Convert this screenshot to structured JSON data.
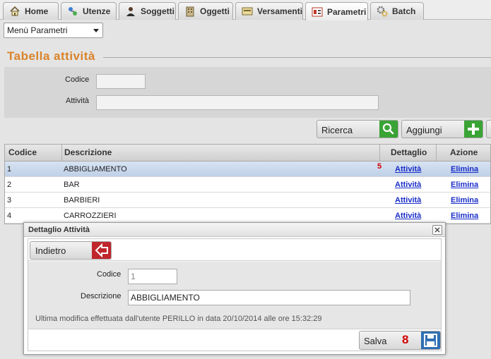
{
  "tabs": [
    {
      "label": "Home",
      "icon": "home-icon"
    },
    {
      "label": "Utenze",
      "icon": "network-icon"
    },
    {
      "label": "Soggetti",
      "icon": "person-icon"
    },
    {
      "label": "Oggetti",
      "icon": "building-icon"
    },
    {
      "label": "Versamenti",
      "icon": "payment-icon"
    },
    {
      "label": "Parametri",
      "icon": "parameters-icon",
      "active": true
    },
    {
      "label": "Batch",
      "icon": "gears-icon"
    }
  ],
  "toolbar": {
    "menu_select": "Menù Parametri"
  },
  "section": {
    "title": "Tabella attività"
  },
  "search": {
    "codice_label": "Codice",
    "codice_value": "",
    "attivita_label": "Attività",
    "attivita_value": "",
    "ricerca_label": "Ricerca",
    "aggiungi_label": "Aggiungi"
  },
  "table": {
    "headers": [
      "Codice",
      "Descrizione",
      "Dettaglio",
      "Azione"
    ],
    "rows": [
      {
        "codice": "1",
        "descrizione": "ABBIGLIAMENTO",
        "dettaglio": "Attività",
        "azione": "Elimina",
        "selected": true
      },
      {
        "codice": "2",
        "descrizione": "BAR",
        "dettaglio": "Attività",
        "azione": "Elimina"
      },
      {
        "codice": "3",
        "descrizione": "BARBIERI",
        "dettaglio": "Attività",
        "azione": "Elimina"
      },
      {
        "codice": "4",
        "descrizione": "CARROZZIERI",
        "dettaglio": "Attività",
        "azione": "Elimina"
      }
    ]
  },
  "markers": {
    "row_marker": "5",
    "save_marker": "8"
  },
  "dialog": {
    "title": "Dettaglio Attività",
    "back_label": "Indietro",
    "codice_label": "Codice",
    "codice_value": "1",
    "descrizione_label": "Descrizione",
    "descrizione_value": "ABBIGLIAMENTO",
    "note": "Ultima modifica effettuata dall'utente PERILLO in data 20/10/2014 alle ore 15:32:29",
    "save_label": "Salva"
  },
  "colors": {
    "accent_orange": "#d9832a",
    "link_blue": "#1a2ec8",
    "marker_red": "#d10000",
    "green_btn": "#3aa335"
  }
}
